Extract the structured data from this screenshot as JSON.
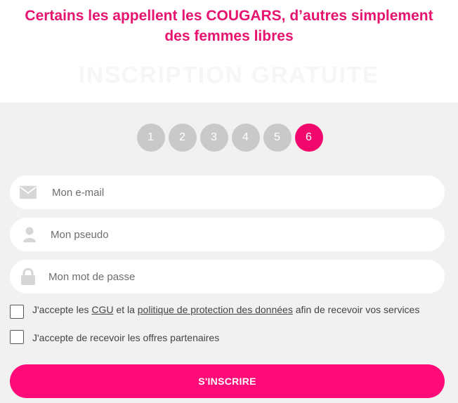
{
  "header": {
    "headline_line1": "Certains les appellent les COUGARS, d’autres simplement",
    "headline_line2": "des femmes libres",
    "ghost_title": "INSCRIPTION GRATUITE"
  },
  "steps": [
    "1",
    "2",
    "3",
    "4",
    "5",
    "6"
  ],
  "active_step": "6",
  "form": {
    "email_placeholder": "Mon e-mail",
    "pseudo_placeholder": "Mon pseudo",
    "password_placeholder": "Mon mot de passe",
    "terms": {
      "prefix": "J'accepte les ",
      "cgu_link": "CGU",
      "middle": " et la ",
      "privacy_link": "politique de protection des données",
      "suffix": " afin de recevoir vos services"
    },
    "offers_label": "J'accepte de recevoir les offres partenaires",
    "submit_label": "S'INSCRIRE"
  },
  "colors": {
    "accent": "#e6136f",
    "button": "#ff0a78",
    "step_active": "#f2076c",
    "step_inactive": "#c9c9c9",
    "panel_bg": "#f1f1f1"
  },
  "icons": {
    "email": "envelope-icon",
    "pseudo": "user-icon",
    "password": "lock-icon"
  }
}
